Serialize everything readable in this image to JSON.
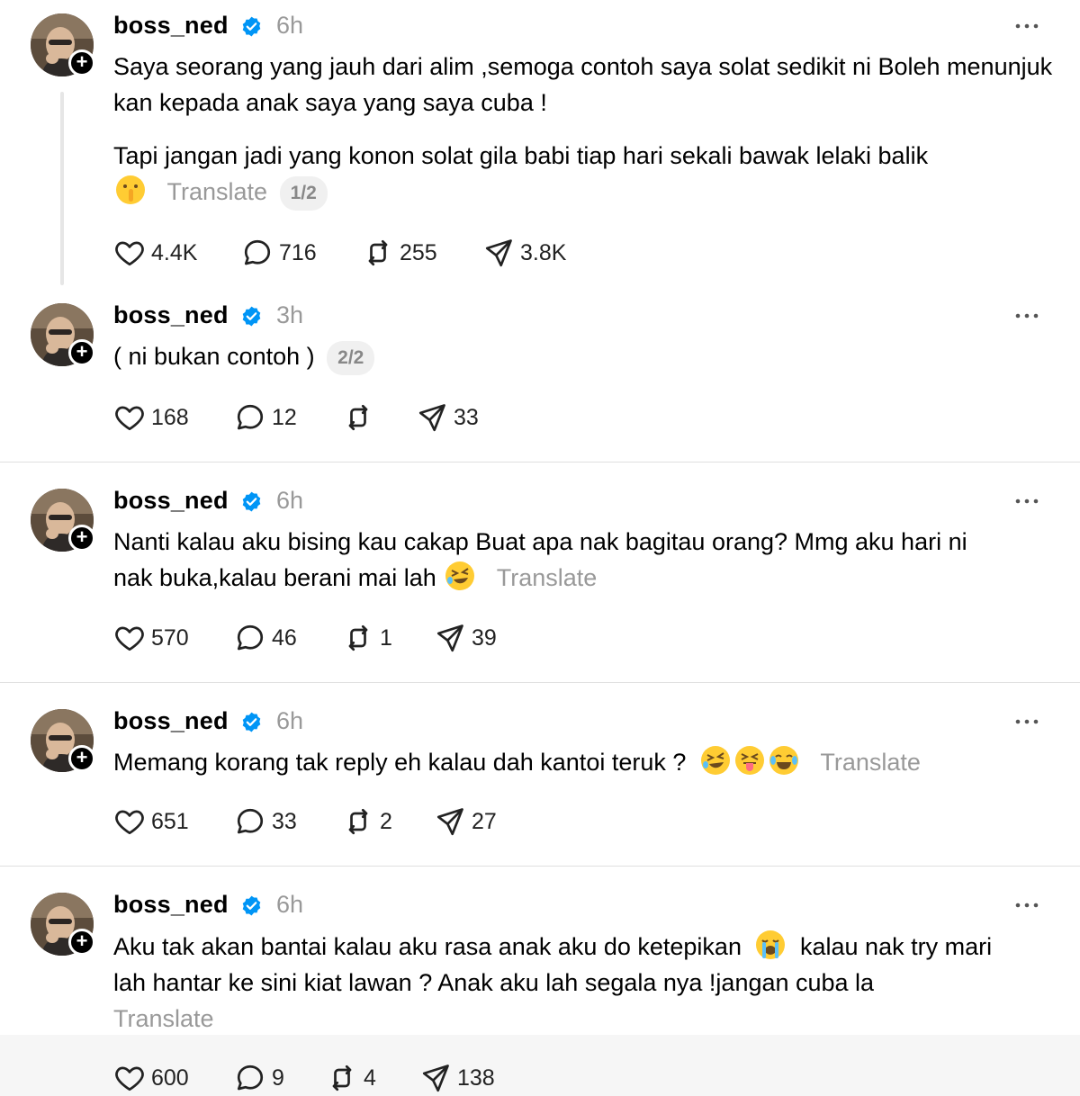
{
  "posts": [
    {
      "username": "boss_ned",
      "time": "6h",
      "paragraphs": [
        "Saya seorang yang jauh dari alim ,semoga contoh saya solat sedikit ni Boleh menunjuk kan kepada anak saya yang saya cuba !",
        "Tapi jangan jadi yang konon solat gila babi tiap hari sekali bawak lelaki balik"
      ],
      "emoji": [
        "shushing-face"
      ],
      "translate": "Translate",
      "counter": "1/2",
      "likes": "4.4K",
      "replies": "716",
      "reposts": "255",
      "shares": "3.8K"
    },
    {
      "username": "boss_ned",
      "time": "3h",
      "text": "( ni bukan contoh )",
      "counter": "2/2",
      "likes": "168",
      "replies": "12",
      "reposts": "",
      "shares": "33"
    },
    {
      "username": "boss_ned",
      "time": "6h",
      "text_line1": "Nanti kalau aku bising kau cakap Buat apa nak bagitau orang? Mmg aku hari ni",
      "text_line2": "nak buka,kalau berani mai lah",
      "emoji": [
        "rolling-laughing-face"
      ],
      "translate": "Translate",
      "likes": "570",
      "replies": "46",
      "reposts": "1",
      "shares": "39"
    },
    {
      "username": "boss_ned",
      "time": "6h",
      "text": "Memang korang tak reply eh kalau dah kantoi teruk ?",
      "emoji": [
        "rolling-laughing-face",
        "squinting-tongue-face",
        "tears-of-joy-face"
      ],
      "translate": "Translate",
      "likes": "651",
      "replies": "33",
      "reposts": "2",
      "shares": "27"
    },
    {
      "username": "boss_ned",
      "time": "6h",
      "text_line1a": "Aku tak akan bantai kalau aku rasa anak aku do ketepikan",
      "text_line1b": "kalau nak try mari",
      "text_line2": "lah hantar ke sini kiat lawan ? Anak aku lah segala nya !jangan cuba la",
      "emoji": [
        "loudly-crying-face"
      ],
      "translate": "Translate",
      "likes": "600",
      "replies": "9",
      "reposts": "4",
      "shares": "138"
    }
  ],
  "colors": {
    "verified": "#0095f6",
    "muted": "#999999",
    "divider": "#e0e0e0"
  }
}
